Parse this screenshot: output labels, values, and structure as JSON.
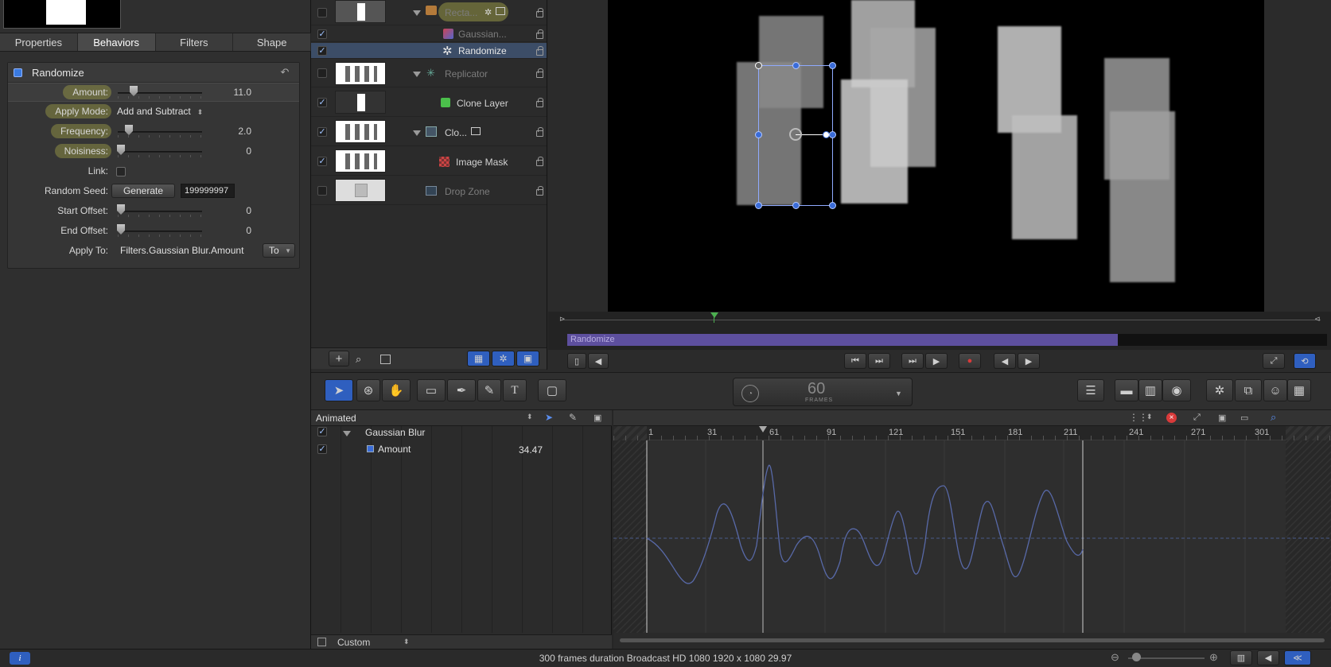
{
  "inspector": {
    "tabs": [
      "Properties",
      "Behaviors",
      "Filters",
      "Shape"
    ],
    "behavior": {
      "title": "Randomize",
      "params": {
        "amount": {
          "label": "Amount:",
          "value": "11.0"
        },
        "apply_mode": {
          "label": "Apply Mode:",
          "value": "Add and Subtract"
        },
        "frequency": {
          "label": "Frequency:",
          "value": "2.0"
        },
        "noisiness": {
          "label": "Noisiness:",
          "value": "0"
        },
        "link": {
          "label": "Link:"
        },
        "random_seed": {
          "label": "Random Seed:",
          "button": "Generate",
          "value": "199999997"
        },
        "start_offset": {
          "label": "Start Offset:",
          "value": "0"
        },
        "end_offset": {
          "label": "End Offset:",
          "value": "0"
        },
        "apply_to": {
          "label": "Apply To:",
          "value": "Filters.Gaussian Blur.Amount",
          "button": "To"
        }
      }
    }
  },
  "layers": [
    {
      "name": "Recta...",
      "checked": false,
      "dim": true
    },
    {
      "name": "Gaussian...",
      "checked": true,
      "dim": true
    },
    {
      "name": "Randomize",
      "checked": true,
      "dim": false,
      "selected": true
    },
    {
      "name": "Replicator",
      "checked": false,
      "dim": true
    },
    {
      "name": "Clone Layer",
      "checked": true,
      "dim": false
    },
    {
      "name": "Clo...",
      "checked": true,
      "dim": false
    },
    {
      "name": "Image Mask",
      "checked": true,
      "dim": false
    },
    {
      "name": "Drop Zone",
      "checked": false,
      "dim": true
    }
  ],
  "mini_timeline": {
    "bar_label": "Randomize"
  },
  "toolbar": {
    "frame_rate": "60",
    "frame_unit": "FRAMES"
  },
  "keyframe_editor": {
    "filter_menu": "Animated",
    "tree": {
      "filter": "Gaussian Blur",
      "param": "Amount",
      "value": "34.47"
    },
    "bottom_menu": "Custom",
    "ruler_labels": [
      "1",
      "31",
      "61",
      "91",
      "121",
      "151",
      "181",
      "211",
      "241",
      "271",
      "301"
    ]
  },
  "status": {
    "text": "300 frames duration Broadcast HD 1080 1920 x 1080 29.97"
  },
  "colors": {
    "accent": "#3a6cd8",
    "behavior_bar": "#5d4f9e",
    "record": "#d93a3a",
    "playhead": "#4caf50"
  }
}
